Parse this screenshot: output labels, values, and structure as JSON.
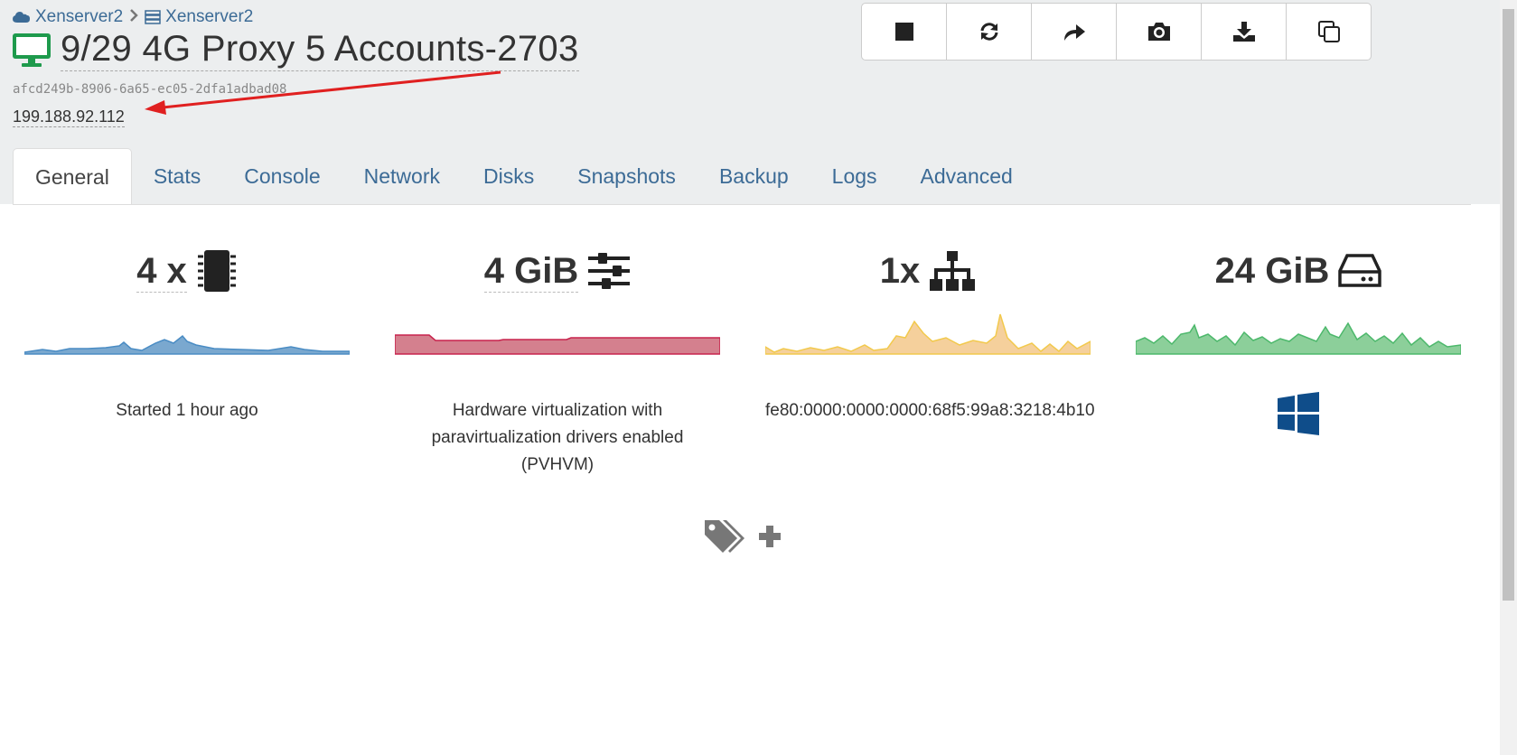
{
  "breadcrumb": {
    "pool": "Xenserver2",
    "host": "Xenserver2"
  },
  "vm": {
    "title": "9/29 4G Proxy 5 Accounts-2703",
    "uuid": "afcd249b-8906-6a65-ec05-2dfa1adbad08",
    "ip": "199.188.92.112",
    "status_color": "#1e9a4c"
  },
  "toolbar": {
    "buttons": [
      "stop-icon",
      "refresh-icon",
      "migrate-icon",
      "snapshot-icon",
      "export-icon",
      "copy-icon"
    ]
  },
  "tabs": [
    "General",
    "Stats",
    "Console",
    "Network",
    "Disks",
    "Snapshots",
    "Backup",
    "Logs",
    "Advanced"
  ],
  "active_tab": "General",
  "stats": {
    "cpu": {
      "label": "4 x",
      "info": "Started 1 hour ago",
      "color": "#5a9ccc"
    },
    "memory": {
      "label": "4 GiB",
      "info": "Hardware virtualization with paravirtualization drivers enabled (PVHVM)",
      "color": "#c8234d"
    },
    "network": {
      "label": "1x",
      "info": "fe80:0000:0000:0000:68f5:99a8:3218:4b10",
      "color": "#f2c94c"
    },
    "disk": {
      "label": "24 GiB",
      "info_icon": "windows-icon",
      "color": "#4cb86b"
    }
  },
  "annotation": {
    "arrow_color": "#e02020"
  }
}
